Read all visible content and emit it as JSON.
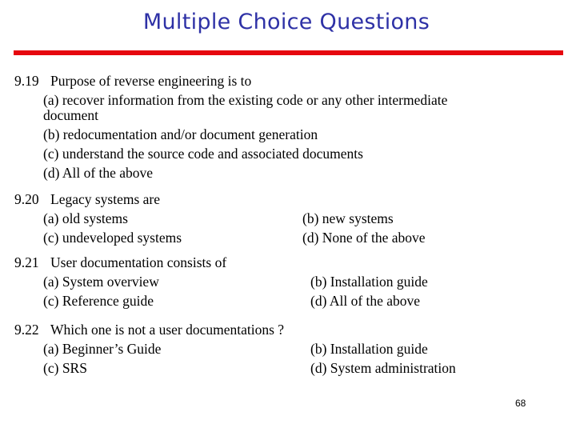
{
  "slide": {
    "title": "Multiple Choice Questions",
    "accent_color": "#e6070f",
    "title_color": "#2e31a6",
    "page_number": "68"
  },
  "questions": [
    {
      "number": "9.19",
      "text": "Purpose of reverse engineering is to",
      "options": [
        {
          "label": "(a)",
          "text": "recover information from the existing code or any other intermediate",
          "continuation": "document"
        },
        {
          "label": "(b)",
          "text": "redocumentation and/or document generation"
        },
        {
          "label": "(c)",
          "text": "understand the source code and associated documents"
        },
        {
          "label": "(d)",
          "text": "All of the above"
        }
      ]
    },
    {
      "number": "9.20",
      "text": "Legacy systems are",
      "options": [
        {
          "label": "(a)",
          "text": "old systems"
        },
        {
          "label": "(b)",
          "text": "new systems"
        },
        {
          "label": "(c)",
          "text": "undeveloped systems"
        },
        {
          "label": "(d)",
          "text": "None of the above"
        }
      ]
    },
    {
      "number": "9.21",
      "text": "User documentation consists of",
      "options": [
        {
          "label": "(a)",
          "text": "System overview"
        },
        {
          "label": "(b)",
          "text": "Installation guide"
        },
        {
          "label": "(c)",
          "text": "Reference guide"
        },
        {
          "label": "(d)",
          "text": "All of the above"
        }
      ]
    },
    {
      "number": "9.22",
      "text": "Which one is not a user documentations ?",
      "options": [
        {
          "label": "(a)",
          "text": "Beginner’s Guide"
        },
        {
          "label": "(b)",
          "text": "Installation guide"
        },
        {
          "label": "(c)",
          "text": "SRS"
        },
        {
          "label": "(d)",
          "text": "System administration"
        }
      ]
    }
  ]
}
